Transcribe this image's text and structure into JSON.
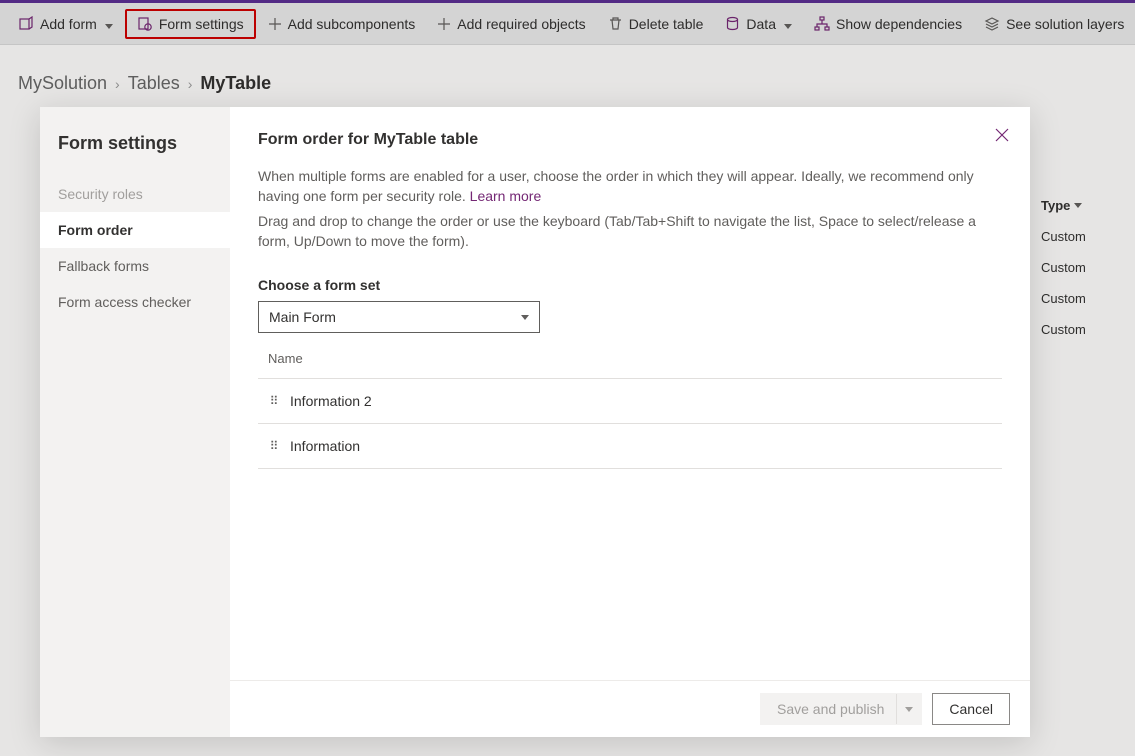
{
  "toolbar": {
    "addForm": "Add form",
    "formSettings": "Form settings",
    "addSubcomponents": "Add subcomponents",
    "addRequiredObjects": "Add required objects",
    "deleteTable": "Delete table",
    "data": "Data",
    "showDependencies": "Show dependencies",
    "seeSolutionLayers": "See solution layers"
  },
  "breadcrumb": {
    "root": "MySolution",
    "mid": "Tables",
    "current": "MyTable"
  },
  "bgTable": {
    "typeHeader": "Type",
    "rows": [
      "Custom",
      "Custom",
      "Custom",
      "Custom"
    ]
  },
  "dialog": {
    "sidebarTitle": "Form settings",
    "sideItems": {
      "securityRoles": "Security roles",
      "formOrder": "Form order",
      "fallbackForms": "Fallback forms",
      "formAccessChecker": "Form access checker"
    },
    "title": "Form order for MyTable table",
    "help1": "When multiple forms are enabled for a user, choose the order in which they will appear. Ideally, we recommend only having one form per security role. ",
    "learnMore": "Learn more",
    "help2": "Drag and drop to change the order or use the keyboard (Tab/Tab+Shift to navigate the list, Space to select/release a form, Up/Down to move the form).",
    "chooseLabel": "Choose a form set",
    "selectedFormSet": "Main Form",
    "nameHeader": "Name",
    "forms": [
      "Information 2",
      "Information"
    ],
    "saveAndPublish": "Save and publish",
    "cancel": "Cancel"
  }
}
